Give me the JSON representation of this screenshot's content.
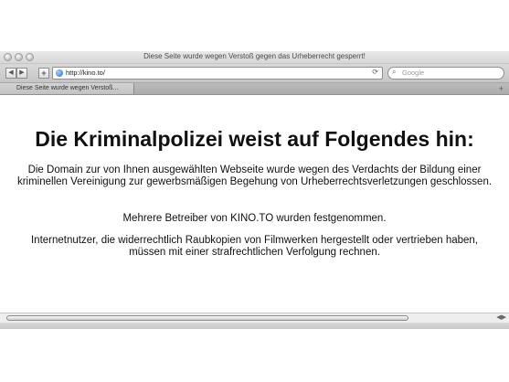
{
  "window": {
    "title": "Diese Seite wurde wegen Verstoß gegen das Urheberrecht gesperrt!"
  },
  "toolbar": {
    "back_icon": "back-arrow-icon",
    "forward_icon": "forward-arrow-icon",
    "add_icon": "plus-icon",
    "url": "http://kino.to/",
    "reload_icon": "reload-icon",
    "search_placeholder": "Google"
  },
  "tabs": [
    {
      "label": "Diese Seite wurde wegen Verstoß..."
    }
  ],
  "page": {
    "heading": "Die Kriminalpolizei weist auf Folgendes hin:",
    "paragraph1": "Die Domain zur von Ihnen ausgewählten Webseite wurde wegen des Verdachts der Bildung einer kriminellen Vereinigung zur gewerbsmäßigen Begehung von Urheberrechtsverletzungen geschlossen.",
    "paragraph2": "Mehrere Betreiber von KINO.TO wurden festgenommen.",
    "paragraph3": "Internetnutzer, die widerrechtlich Raubkopien von Filmwerken hergestellt oder vertrieben haben, müssen mit einer strafrechtlichen Verfolgung rechnen."
  }
}
